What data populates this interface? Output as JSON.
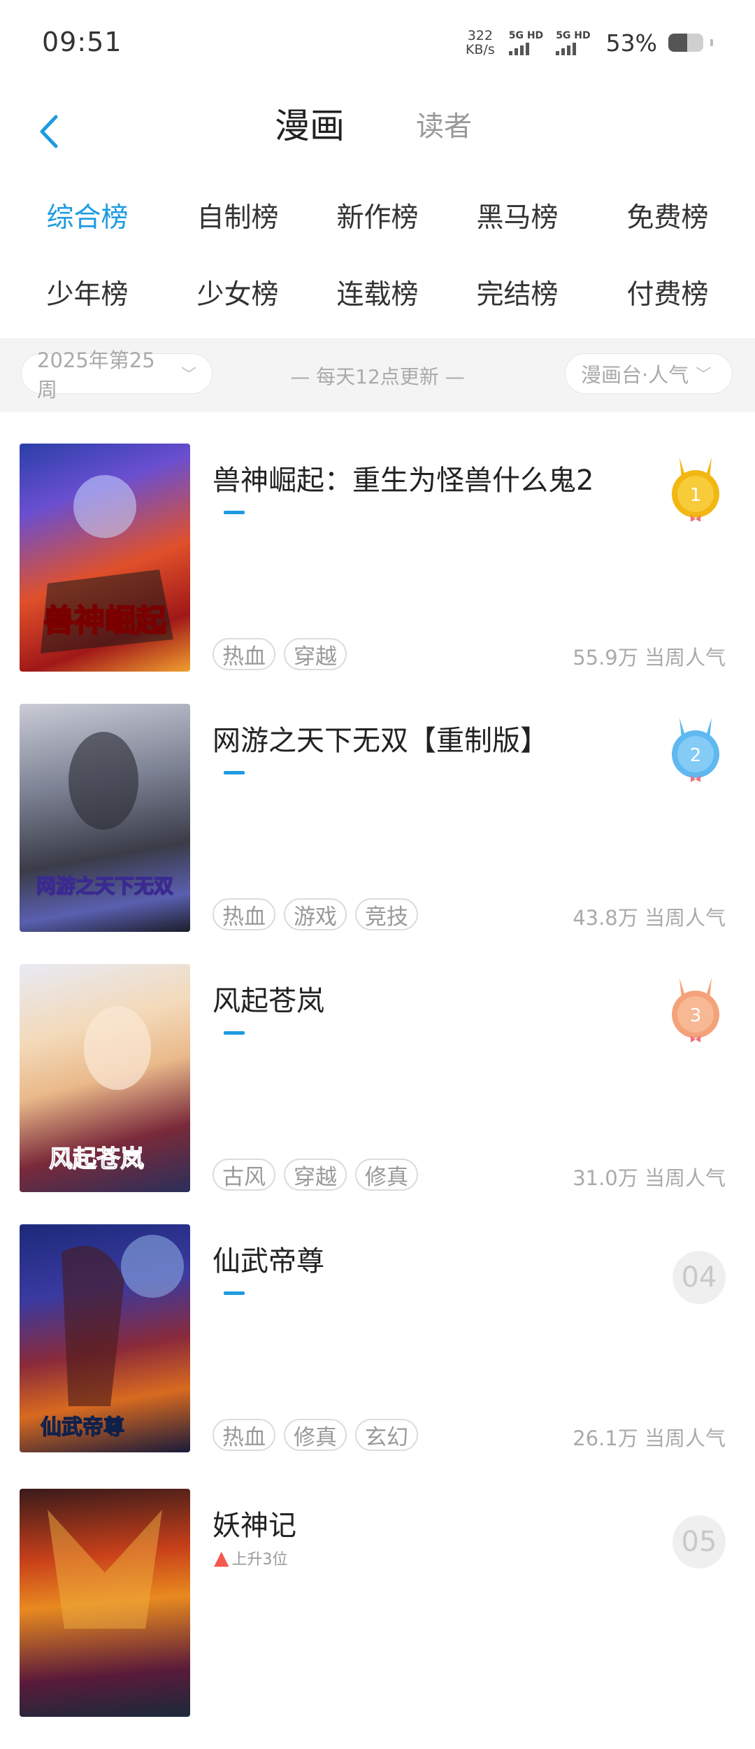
{
  "status_bar": {
    "time": "09:51",
    "net_speed_value": "322",
    "net_speed_unit": "KB/s",
    "sim1_label": "5G HD",
    "sim2_label": "5G HD",
    "battery_percent": "53%",
    "battery_level": 0.53
  },
  "header": {
    "back_icon": "chevron-left-icon",
    "tabs": [
      {
        "label": "漫画",
        "active": true
      },
      {
        "label": "读者",
        "active": false
      }
    ]
  },
  "categories": [
    {
      "label": "综合榜",
      "active": true
    },
    {
      "label": "自制榜"
    },
    {
      "label": "新作榜"
    },
    {
      "label": "黑马榜"
    },
    {
      "label": "免费榜"
    },
    {
      "label": "少年榜"
    },
    {
      "label": "少女榜"
    },
    {
      "label": "连载榜"
    },
    {
      "label": "完结榜"
    },
    {
      "label": "付费榜"
    }
  ],
  "filter": {
    "week": "2025年第25周",
    "update_note": "— 每天12点更新 —",
    "sort": "漫画台·人气"
  },
  "colors": {
    "accent": "#1e9be0",
    "gold": "#f2b712",
    "silver_blue": "#5fb8f0",
    "bronze": "#f4a27a",
    "trend_up": "#f25a4e"
  },
  "list": [
    {
      "rank": "1",
      "title": "兽神崛起：重生为怪兽什么鬼2",
      "tags": [
        "热血",
        "穿越"
      ],
      "popularity": "55.9万",
      "popularity_label": "当周人气",
      "cover_title": "兽神崛起"
    },
    {
      "rank": "2",
      "title": "网游之天下无双【重制版】",
      "tags": [
        "热血",
        "游戏",
        "竞技"
      ],
      "popularity": "43.8万",
      "popularity_label": "当周人气",
      "cover_title": "网游之天下无双"
    },
    {
      "rank": "3",
      "title": "风起苍岚",
      "tags": [
        "古风",
        "穿越",
        "修真"
      ],
      "popularity": "31.0万",
      "popularity_label": "当周人气",
      "cover_title": "风起苍岚"
    },
    {
      "rank": "04",
      "title": "仙武帝尊",
      "tags": [
        "热血",
        "修真",
        "玄幻"
      ],
      "popularity": "26.1万",
      "popularity_label": "当周人气",
      "cover_title": "仙武帝尊"
    },
    {
      "rank": "05",
      "title": "妖神记",
      "trend": "上升3位",
      "tags": [],
      "popularity": "",
      "popularity_label": "",
      "cover_title": ""
    }
  ]
}
